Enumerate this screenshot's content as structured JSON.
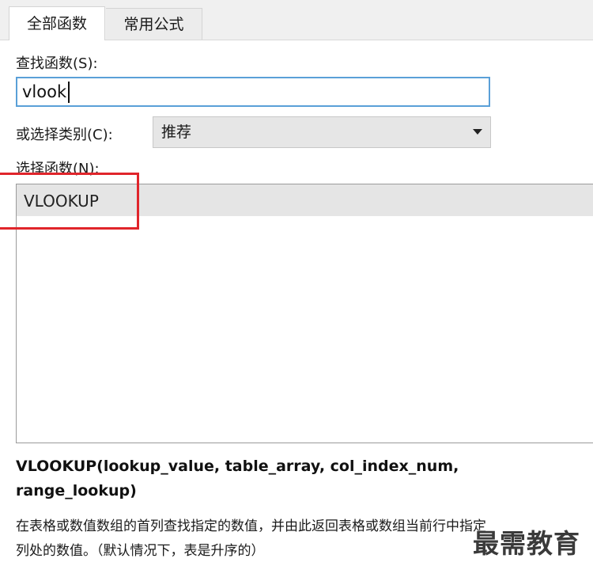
{
  "tabs": {
    "all_functions": "全部函数",
    "common_formulas": "常用公式"
  },
  "search": {
    "label": "查找函数(S):",
    "value": "vlook"
  },
  "category": {
    "label": "或选择类别(C):",
    "selected": "推荐"
  },
  "function_list": {
    "label": "选择函数(N):",
    "items": [
      "VLOOKUP"
    ]
  },
  "details": {
    "signature": "VLOOKUP(lookup_value, table_array, col_index_num, range_lookup)",
    "description": "在表格或数值数组的首列查找指定的数值，并由此返回表格或数组当前行中指定列处的数值。（默认情况下，表是升序的）"
  },
  "watermark": "最需教育",
  "colors": {
    "highlight": "#e0252b",
    "input_border": "#5aa0d8"
  }
}
